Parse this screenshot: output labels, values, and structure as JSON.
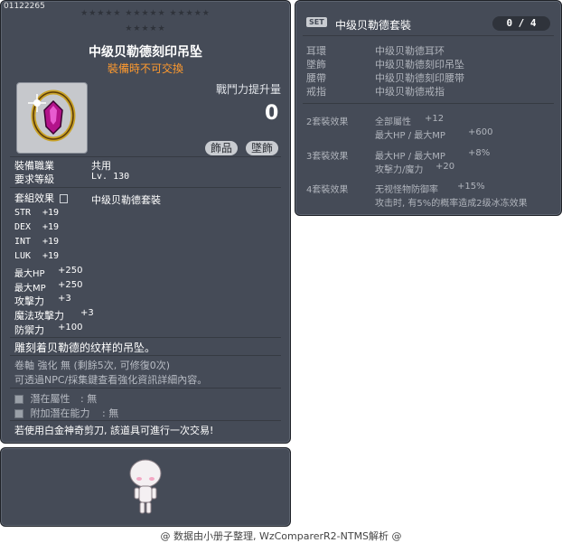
{
  "item": {
    "id": "01122265",
    "stars_row1": "★★★★★   ★★★★★   ★★★★★",
    "stars_row2": "★★★★★",
    "name": "中级贝勒德刻印吊坠",
    "tradeable_note": "裝備時不可交換",
    "power_label": "戰鬥力提升量",
    "power_value": "0",
    "badges": [
      "飾品",
      "墜飾"
    ],
    "job_label": "裝備職業",
    "job_value": "共用",
    "level_label": "要求等級",
    "level_value": "Lv. 130",
    "set_label": "套組效果",
    "set_name": "中级贝勒德套裝",
    "stats": [
      {
        "label": "STR",
        "value": "+19"
      },
      {
        "label": "DEX",
        "value": "+19"
      },
      {
        "label": "INT",
        "value": "+19"
      },
      {
        "label": "LUK",
        "value": "+19"
      },
      {
        "label": "最大HP",
        "value": "+250"
      },
      {
        "label": "最大MP",
        "value": "+250"
      },
      {
        "label": "攻擊力",
        "value": "+3"
      },
      {
        "label": "魔法攻擊力",
        "value": "+3"
      },
      {
        "label": "防禦力",
        "value": "+100"
      }
    ],
    "description": "雕刻着贝勒德的纹样的吊坠。",
    "scroll_info": "卷軸 強化 無 (剩餘5次, 可修復0次)",
    "scroll_help": "可透過NPC/採集鍵查看強化資訊詳細內容。",
    "potential_label": "潛在屬性",
    "potential_value": ": 無",
    "bonus_potential_label": "附加潛在能力",
    "bonus_potential_value": ": 無",
    "scissors_note": "若使用白金神奇剪刀, 該道具可進行一次交易!"
  },
  "set": {
    "tag": "SET",
    "title": "中级贝勒德套裝",
    "count": "0 / 4",
    "parts": [
      {
        "slot": "耳環",
        "name": "中级贝勒德耳环"
      },
      {
        "slot": "墜飾",
        "name": "中级贝勒德刻印吊坠"
      },
      {
        "slot": "腰帶",
        "name": "中级贝勒德刻印腰带"
      },
      {
        "slot": "戒指",
        "name": "中级贝勒德戒指"
      }
    ],
    "effects": [
      {
        "label": "2套裝效果",
        "lines": [
          {
            "text": "全部屬性",
            "value": "+12"
          },
          {
            "text": "最大HP / 最大MP",
            "value": "+600"
          }
        ]
      },
      {
        "label": "3套裝效果",
        "lines": [
          {
            "text": "最大HP / 最大MP",
            "value": "+8%"
          },
          {
            "text": "攻擊力/魔力",
            "value": "+20"
          }
        ]
      },
      {
        "label": "4套裝效果",
        "lines": [
          {
            "text": "无视怪物防御率",
            "value": "+15%"
          },
          {
            "text": "攻击时, 有5%的概率造成2级冰冻效果",
            "value": ""
          }
        ]
      }
    ]
  },
  "footer": "@ 数据由小册子整理, WzComparerR2-NTMS解析 @",
  "colors": {
    "panel": "#454b57",
    "untradeable": "#ff9a2e"
  }
}
